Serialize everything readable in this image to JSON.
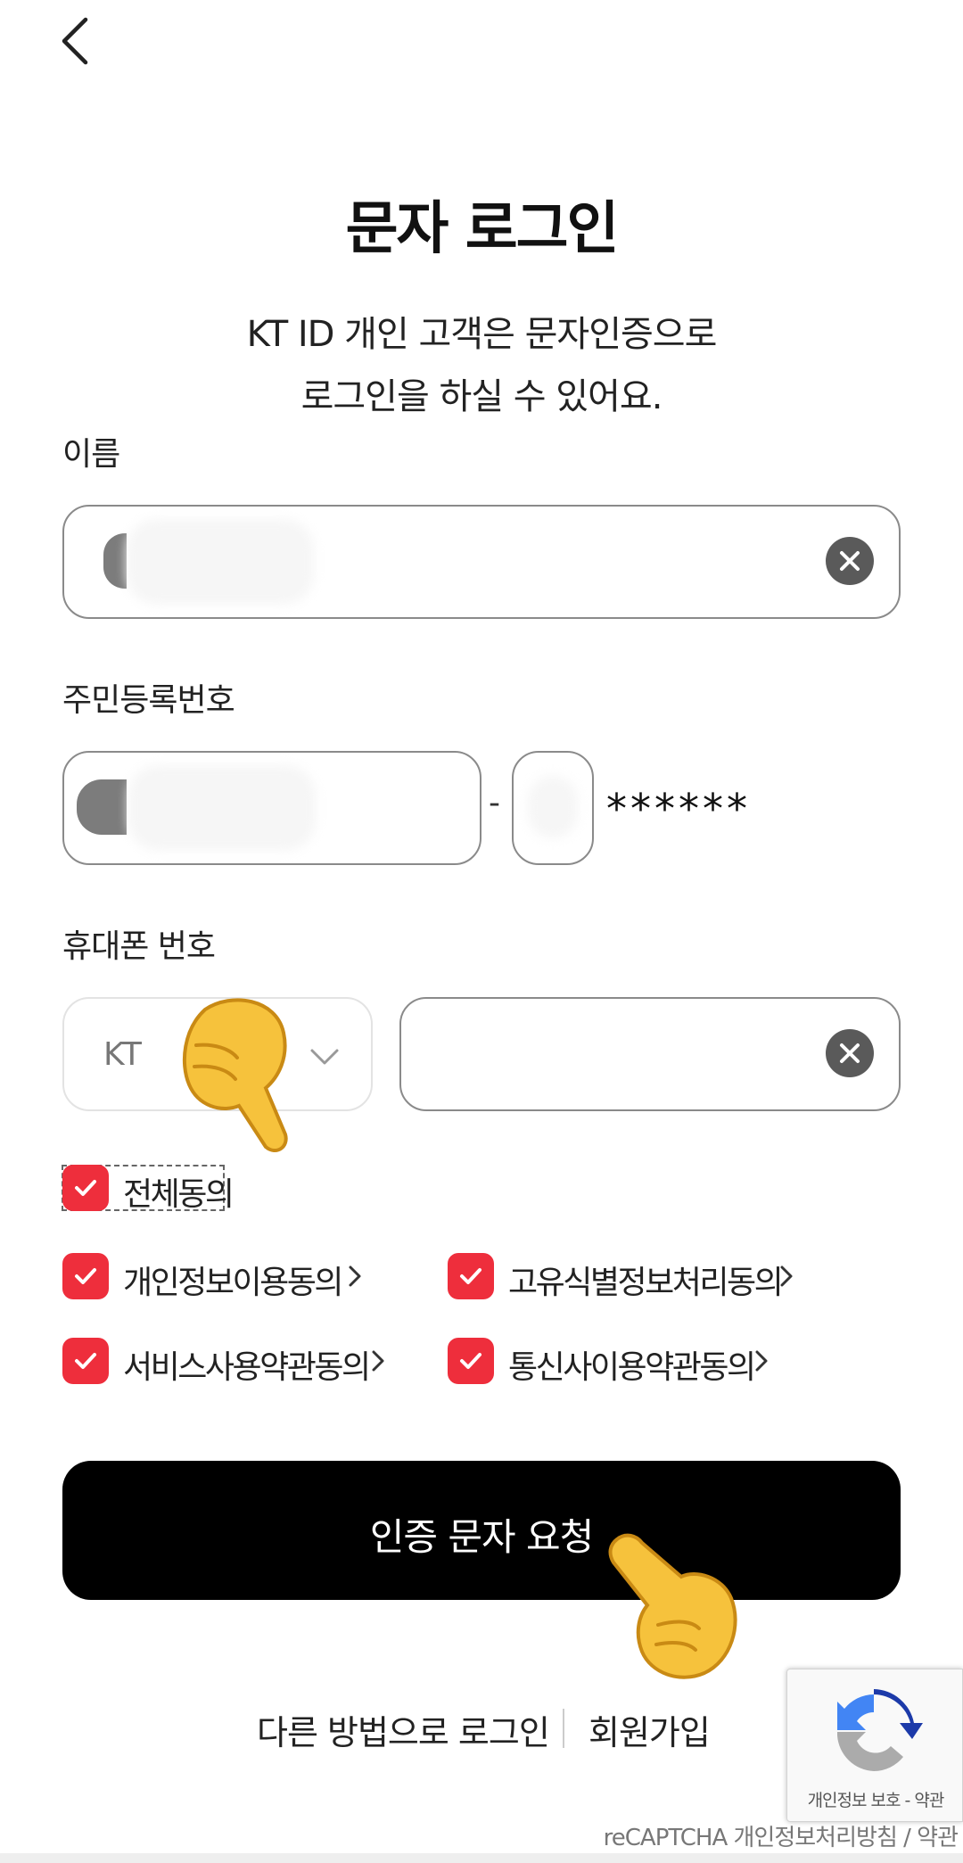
{
  "header": {
    "back_icon": "chevron-left-icon"
  },
  "title": "문자 로그인",
  "subtitle_lines": [
    "KT ID 개인 고객은 문자인증으로",
    "로그인을 하실 수 있어요."
  ],
  "name_field": {
    "label": "이름",
    "value": ""
  },
  "resident_field": {
    "label": "주민등록번호",
    "front_value": "",
    "back_first_value": "",
    "masked": "******",
    "separator": "-"
  },
  "phone_field": {
    "label": "휴대폰 번호",
    "carrier_selected": "KT",
    "number_value": ""
  },
  "agreements": {
    "all": {
      "label": "전체동의",
      "checked": true
    },
    "items": [
      {
        "label": "개인정보이용동의",
        "checked": true
      },
      {
        "label": "고유식별정보처리동의",
        "checked": true
      },
      {
        "label": "서비스사용약관동의",
        "checked": true
      },
      {
        "label": "통신사이용약관동의",
        "checked": true
      }
    ]
  },
  "submit_label": "인증 문자 요청",
  "bottom_links": {
    "other_login": "다른 방법으로 로그인",
    "signup": "회원가입"
  },
  "recaptcha": {
    "badge_text": "개인정보 보호 - 약관",
    "footer_text": "reCAPTCHA 개인정보처리방침 / 약관"
  },
  "colors": {
    "accent_red": "#ee2e3c",
    "button_black": "#000000"
  }
}
